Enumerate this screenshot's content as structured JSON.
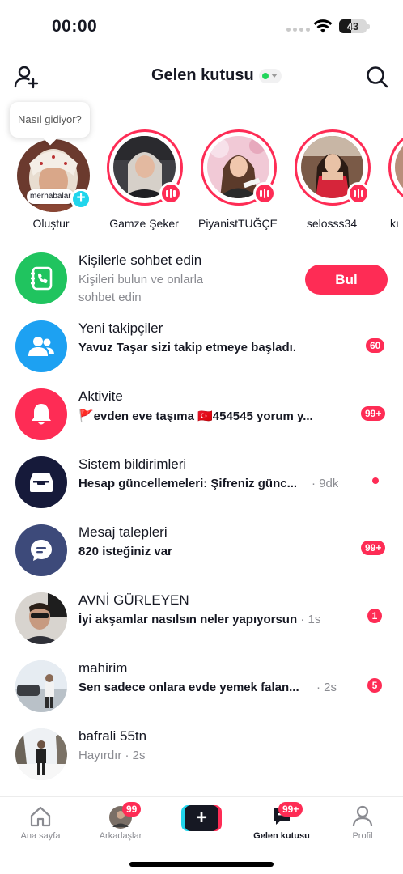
{
  "status_bar": {
    "time": "00:00",
    "battery": "43",
    "battery_level_percent": 43
  },
  "header": {
    "title": "Gelen kutusu",
    "online_color": "#20d55a"
  },
  "tooltip": {
    "text": "Nasıl gidiyor?"
  },
  "stories": {
    "own": {
      "label": "merhabalar",
      "name": "Oluştur"
    },
    "items": [
      {
        "name": "Gamze Şeker"
      },
      {
        "name": "PiyanistTUĞÇE"
      },
      {
        "name": "selosss34"
      },
      {
        "name": "kı"
      }
    ]
  },
  "rows": {
    "contacts": {
      "title": "Kişilerle sohbet edin",
      "sub1": "Kişileri bulun ve onlarla",
      "sub2": "sohbet edin",
      "button": "Bul",
      "icon": "phone-book-icon"
    },
    "followers": {
      "title": "Yeni takipçiler",
      "sub": "Yavuz Taşar sizi takip etmeye başladı.",
      "badge": "60",
      "icon": "people-icon"
    },
    "activity": {
      "title": "Aktivite",
      "sub": "🚩evden eve taşıma 🇹🇷454545 yorum y...",
      "badge": "99+",
      "icon": "bell-icon"
    },
    "system": {
      "title": "Sistem bildirimleri",
      "sub": "Hesap güncellemeleri: Şifreniz günc...",
      "meta": " · 9dk",
      "icon": "inbox-icon"
    },
    "requests": {
      "title": "Mesaj talepleri",
      "sub": "820 isteğiniz var",
      "badge": "99+",
      "icon": "chat-bubble-icon"
    },
    "avni": {
      "title": "AVNİ GÜRLEYEN",
      "sub": "İyi akşamlar nasılsın neler yapıyorsun",
      "meta": " · 1s",
      "badge": "1"
    },
    "mahirim": {
      "title": "mahirim",
      "sub": "Sen sadece onlara evde yemek falan...",
      "meta": " · 2s",
      "badge": "5"
    },
    "bafrali": {
      "title": "bafrali 55tn",
      "sub": "Hayırdır",
      "meta": " · 2s"
    }
  },
  "tabs": {
    "home": "Ana sayfa",
    "friends": "Arkadaşlar",
    "friends_badge": "99",
    "inbox": "Gelen kutusu",
    "inbox_badge": "99+",
    "profile": "Profil"
  },
  "colors": {
    "accent": "#fe2c55",
    "cyan": "#20d5ec",
    "green": "#20c45f",
    "blue": "#1da1f2",
    "navy": "#161a3a",
    "indigo": "#3d4a7a"
  }
}
